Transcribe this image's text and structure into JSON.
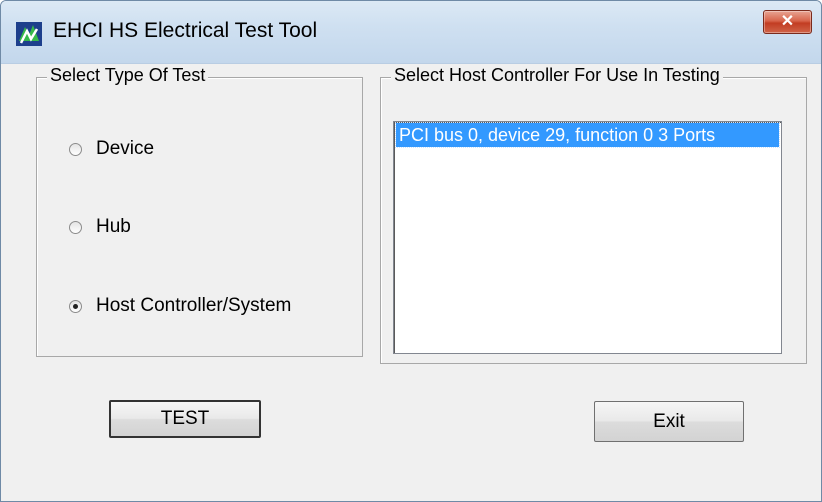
{
  "window": {
    "title": "EHCI HS Electrical Test Tool",
    "close_label": "✕"
  },
  "test_type": {
    "legend": "Select Type Of Test",
    "options": [
      {
        "label": "Device",
        "checked": false
      },
      {
        "label": "Hub",
        "checked": false
      },
      {
        "label": "Host Controller/System",
        "checked": true
      }
    ]
  },
  "host_controller": {
    "legend": "Select Host Controller For Use In Testing",
    "items": [
      {
        "label": "PCI bus 0, device 29, function 0  3 Ports",
        "selected": true
      }
    ]
  },
  "buttons": {
    "test_label": "TEST",
    "exit_label": "Exit"
  },
  "colors": {
    "selection": "#3399ff",
    "close_button": "#c8452a"
  }
}
